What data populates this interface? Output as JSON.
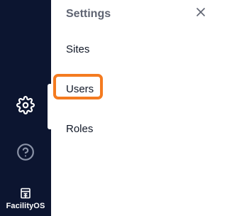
{
  "sidebar": {
    "brand_name": "FacilityOS",
    "settings_icon": "gear-icon",
    "help_icon": "help-circle-icon",
    "logo_icon": "building-logo-icon",
    "background_color": "#0c1530"
  },
  "panel": {
    "title": "Settings",
    "close_icon": "close-icon",
    "items": [
      {
        "label": "Sites"
      },
      {
        "label": "Users",
        "highlighted": true
      },
      {
        "label": "Roles"
      }
    ]
  },
  "highlight_color": "#f47b20"
}
